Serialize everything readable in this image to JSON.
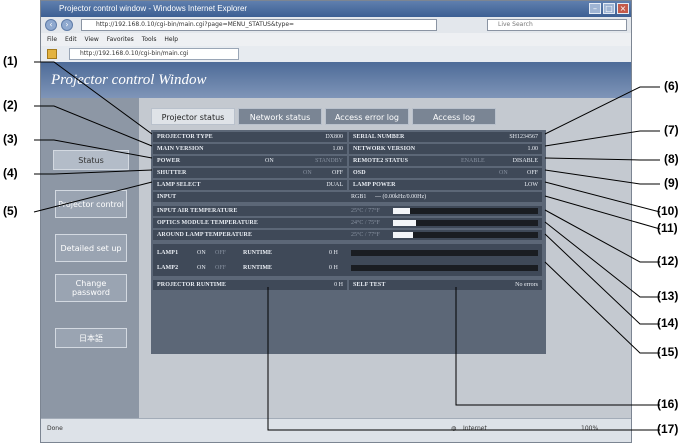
{
  "window": {
    "title": "Projector control window - Windows Internet Explorer",
    "url": "http://192.168.0.10/cgi-bin/main.cgi?page=MENU_STATUS&type=",
    "search_placeholder": "Live Search",
    "menu": [
      "File",
      "Edit",
      "View",
      "Favorites",
      "Tools",
      "Help"
    ],
    "tab_label": "http://192.168.0.10/cgi-bin/main.cgi",
    "status_zone": "Internet",
    "zoom": "100%",
    "status_left": "Done"
  },
  "header": {
    "title": "Projector control Window"
  },
  "left_nav": {
    "status": "Status",
    "projector_control": "Projector control",
    "detailed_set_up": "Detailed set up",
    "change_password": "Change password",
    "language": "日本語"
  },
  "tabs": [
    {
      "label": "Projector status",
      "active": true
    },
    {
      "label": "Network status",
      "active": false
    },
    {
      "label": "Access error log",
      "active": false
    },
    {
      "label": "Access log",
      "active": false
    }
  ],
  "status": {
    "projector_type": {
      "label": "PROJECTOR TYPE",
      "value": "DX800"
    },
    "serial_number": {
      "label": "SERIAL NUMBER",
      "value": "SH1234567"
    },
    "main_version": {
      "label": "MAIN VERSION",
      "value": "1.00"
    },
    "network_version": {
      "label": "NETWORK VERSION",
      "value": "1.00"
    },
    "power": {
      "label": "POWER",
      "on": "ON",
      "standby": "STANDBY"
    },
    "remote2_status": {
      "label": "REMOTE2 STATUS",
      "enable": "ENABLE",
      "disable": "DISABLE"
    },
    "shutter": {
      "label": "SHUTTER",
      "on": "ON",
      "off": "OFF"
    },
    "osd": {
      "label": "OSD",
      "on": "ON",
      "off": "OFF"
    },
    "lamp_select": {
      "label": "LAMP SELECT",
      "value": "DUAL"
    },
    "lamp_power": {
      "label": "LAMP POWER",
      "value": "LOW"
    },
    "input": {
      "label": "INPUT",
      "value": "RGB1",
      "signal": "--- (0.00kHz/0.00Hz)"
    },
    "input_air_temp": {
      "label": "INPUT AIR TEMPERATURE",
      "value": "25°C / 77°F",
      "level": 0.12
    },
    "optics_module_temp": {
      "label": "OPTICS MODULE TEMPERATURE",
      "value": "24°C / 75°F",
      "level": 0.16
    },
    "around_lamp_temp": {
      "label": "AROUND LAMP TEMPERATURE",
      "value": "25°C / 77°F",
      "level": 0.14
    },
    "lamp1": {
      "label": "LAMP1",
      "on": "ON",
      "off": "OFF",
      "runtime_label": "RUNTIME",
      "runtime": "0 H"
    },
    "lamp2": {
      "label": "LAMP2",
      "on": "ON",
      "off": "OFF",
      "runtime_label": "RUNTIME",
      "runtime": "0 H"
    },
    "projector_runtime": {
      "label": "PROJECTOR RUNTIME",
      "value": "0 H"
    },
    "self_test": {
      "label": "SELF TEST",
      "value": "No errors"
    }
  },
  "callouts": {
    "c1": "(1)",
    "c2": "(2)",
    "c3": "(3)",
    "c4": "(4)",
    "c5": "(5)",
    "c6": "(6)",
    "c7": "(7)",
    "c8": "(8)",
    "c9": "(9)",
    "c10": "(10)",
    "c11": "(11)",
    "c12": "(12)",
    "c13": "(13)",
    "c14": "(14)",
    "c15": "(15)",
    "c16": "(16)",
    "c17": "(17)"
  }
}
